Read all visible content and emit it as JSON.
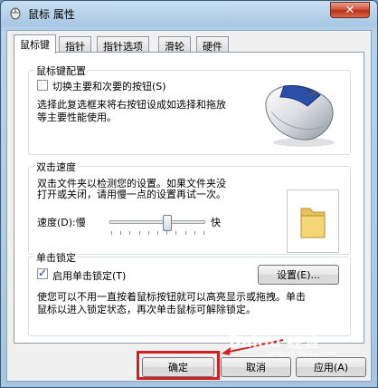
{
  "window": {
    "title": "鼠标 属性",
    "close_label": "✕"
  },
  "tabs": [
    "鼠标键",
    "指针",
    "指针选项",
    "滑轮",
    "硬件"
  ],
  "button_config": {
    "group_title": "鼠标键配置",
    "switch_checkbox_label": "切换主要和次要的按钮(S)",
    "switch_checked": false,
    "description_line1": "选择此复选框来将右按钮设成如选择和拖放",
    "description_line2": "等主要性能使用。"
  },
  "double_click": {
    "group_title": "双击速度",
    "description_line1": "双击文件夹以检测您的设置。如果文件夹没",
    "description_line2": "打开或关闭，请用慢一点的设置再试一次。",
    "speed_label": "速度(D):慢",
    "fast_label": "快",
    "speed_value": 0.6
  },
  "click_lock": {
    "group_title": "单击锁定",
    "checkbox_label": "启用单击锁定(T)",
    "checked": true,
    "settings_button": "设置(E)...",
    "description_line1": "使您可以不用一直按着鼠标按钮就可以高亮显示或拖拽。单击",
    "description_line2": "鼠标以进入锁定状态，再次单击鼠标可解除锁定。"
  },
  "footer": {
    "ok": "确定",
    "cancel": "取消",
    "apply": "应用(A)"
  },
  "watermark": {
    "main": "Baidu 经验",
    "sub": "jingyan.baidu.com"
  },
  "colors": {
    "highlight": "#d41f1f",
    "arrow": "#d41f1f"
  }
}
